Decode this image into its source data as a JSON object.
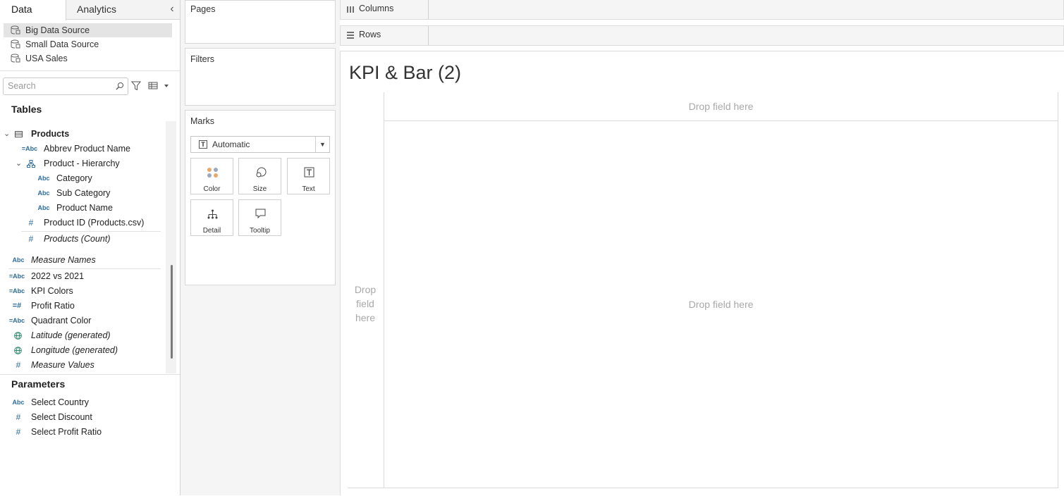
{
  "tabs": {
    "data": "Data",
    "analytics": "Analytics",
    "collapse_icon": "chevron-left-icon"
  },
  "data_sources": [
    {
      "label": "Big Data Source",
      "selected": true
    },
    {
      "label": "Small Data Source",
      "selected": false
    },
    {
      "label": "USA Sales",
      "selected": false
    }
  ],
  "search": {
    "placeholder": "Search"
  },
  "tables": {
    "heading": "Tables",
    "products": "Products",
    "abbrev_product_name": "Abbrev Product Name",
    "product_hierarchy": "Product - Hierarchy",
    "category": "Category",
    "sub_category": "Sub Category",
    "product_name": "Product Name",
    "product_id": "Product ID (Products.csv)",
    "products_count": "Products (Count)"
  },
  "loose_fields": {
    "measure_names": "Measure Names",
    "kpi_2022_vs_2021": "2022 vs 2021",
    "kpi_colors": "KPI Colors",
    "profit_ratio": "Profit Ratio",
    "quadrant_color": "Quadrant Color",
    "latitude": "Latitude (generated)",
    "longitude": "Longitude (generated)",
    "measure_values": "Measure Values"
  },
  "field_types": {
    "abc": "Abc",
    "calc_abc": "=Abc",
    "number": "#",
    "calc_number": "=#"
  },
  "parameters": {
    "heading": "Parameters",
    "select_country": "Select Country",
    "select_discount": "Select Discount",
    "select_profit_ratio": "Select Profit Ratio"
  },
  "cards": {
    "pages": "Pages",
    "filters": "Filters",
    "marks": "Marks",
    "mark_type": "Automatic",
    "buttons": {
      "color": "Color",
      "size": "Size",
      "text": "Text",
      "detail": "Detail",
      "tooltip": "Tooltip"
    }
  },
  "shelves": {
    "columns": "Columns",
    "rows": "Rows"
  },
  "sheet": {
    "title": "KPI & Bar (2)",
    "drop_columns": "Drop field here",
    "drop_rows": "Drop\nfield\nhere",
    "drop_main": "Drop field here"
  },
  "colors": {
    "accent": "#2c6c9e",
    "selected_bg": "#e4e4e4",
    "drop_text": "#a8a8a8"
  }
}
